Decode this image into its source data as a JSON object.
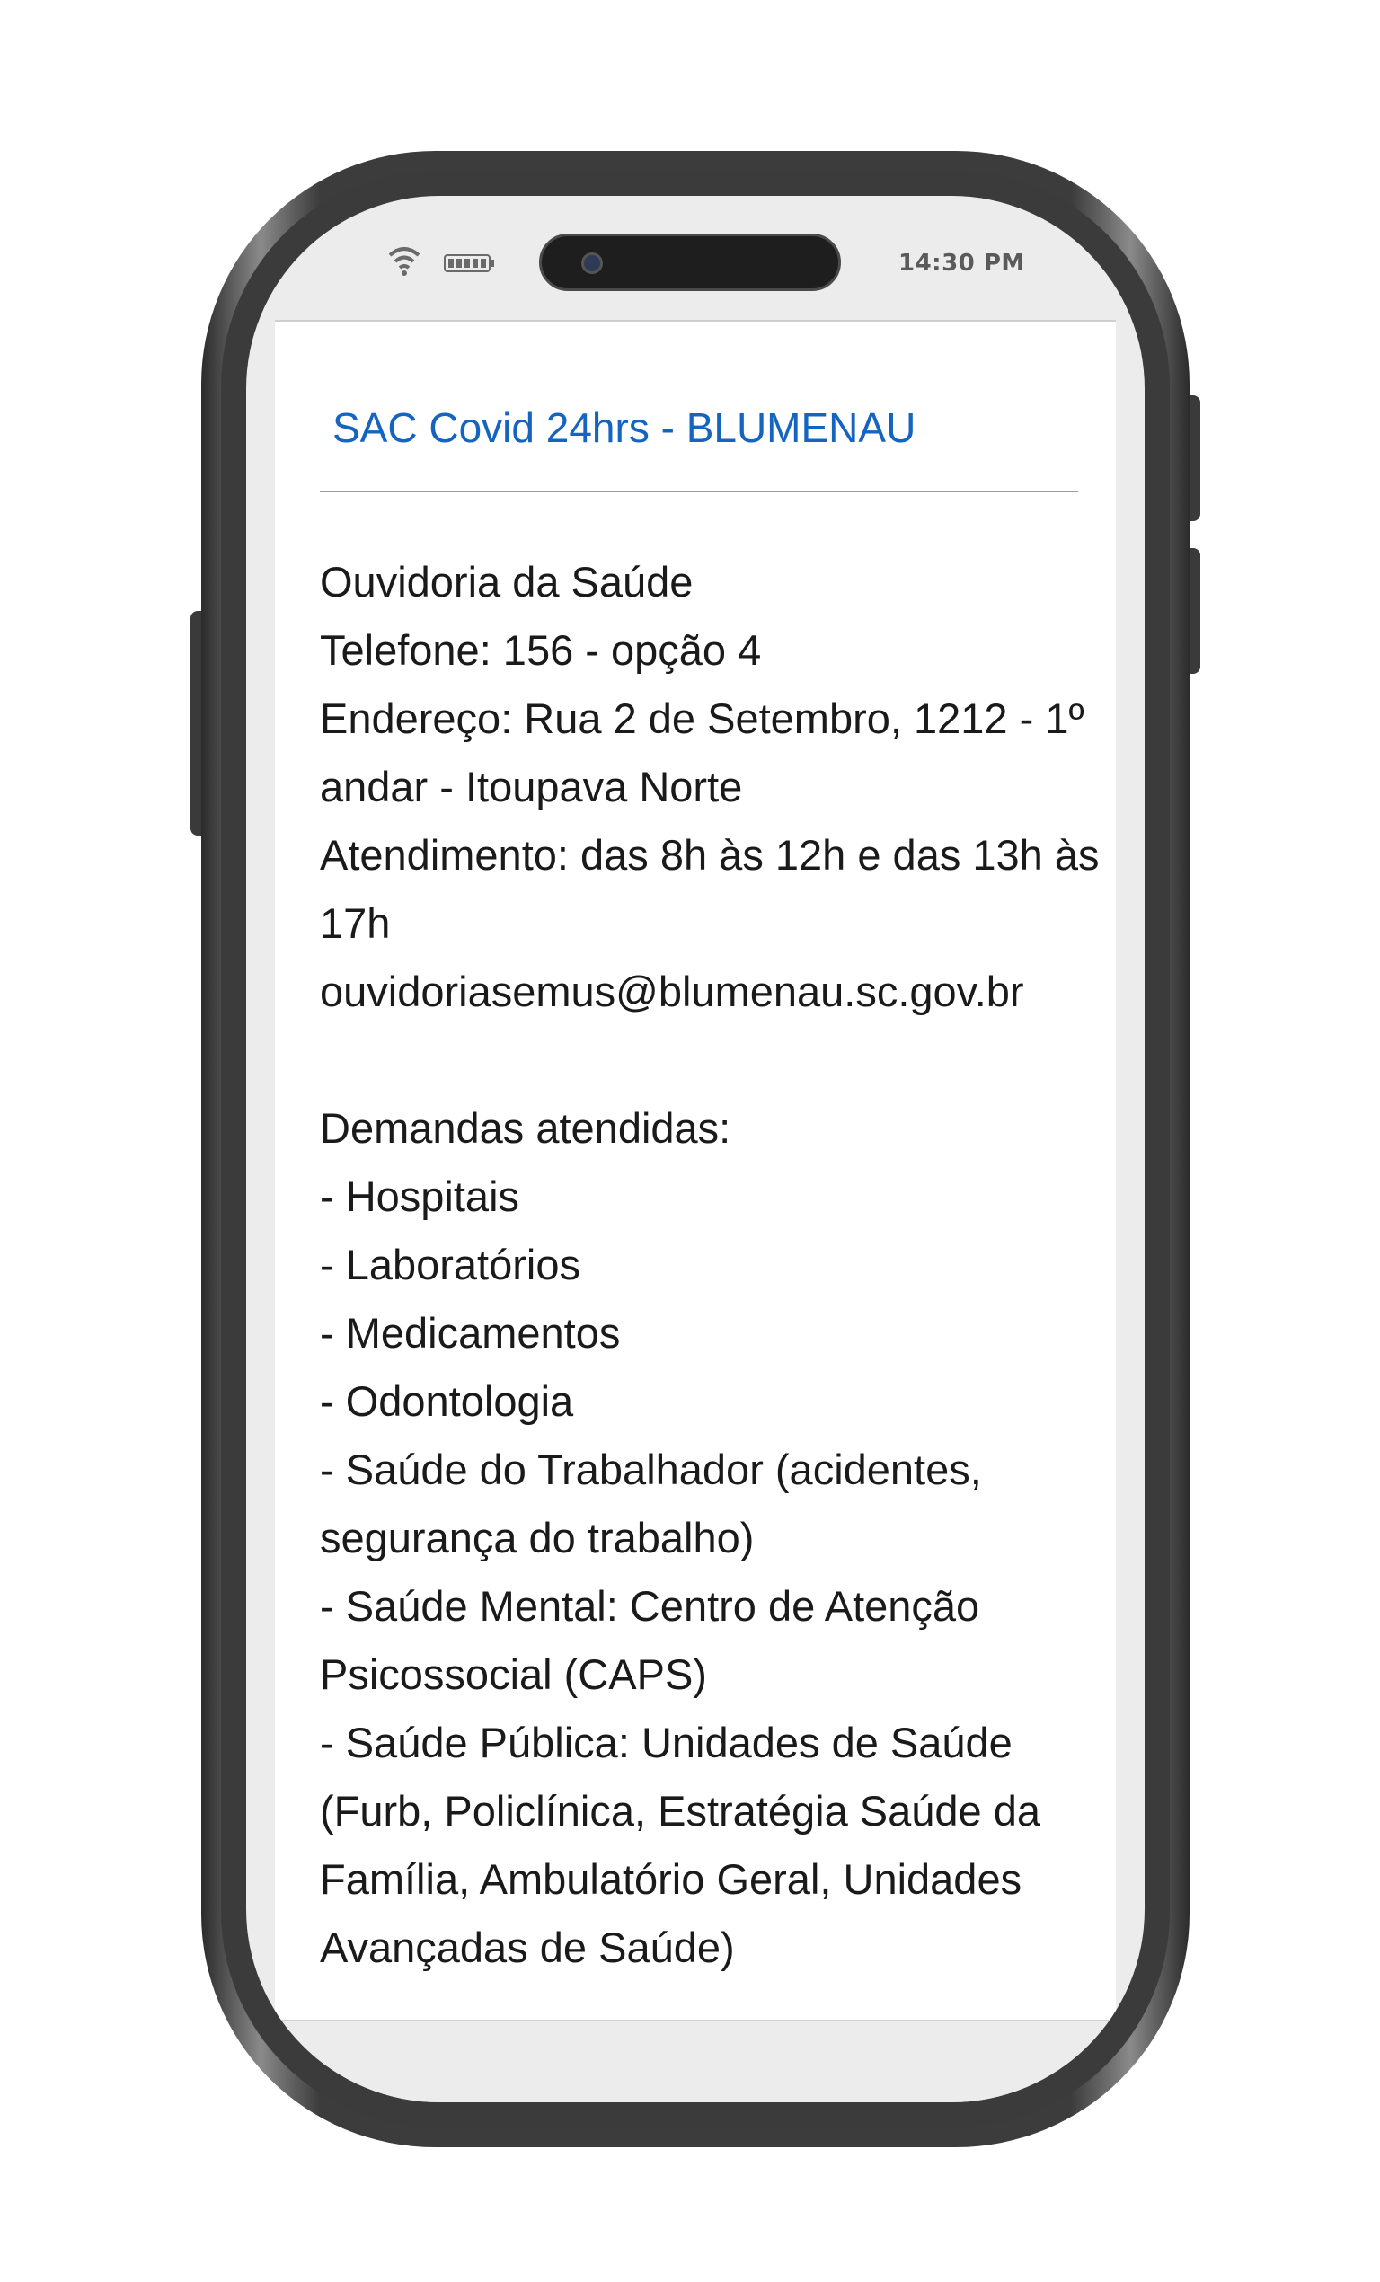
{
  "status_bar": {
    "time": "14:30 PM",
    "icons": [
      "wifi-icon",
      "battery-icon",
      "front-camera-icon"
    ]
  },
  "page": {
    "title": "SAC Covid 24hrs - BLUMENAU",
    "contact": [
      "Ouvidoria da Saúde",
      "Telefone: 156 - opção 4",
      "Endereço: Rua 2 de Setembro, 1212 - 1º",
      "andar - Itoupava Norte",
      "Atendimento: das 8h às 12h e das 13h às",
      "17h",
      "ouvidoriasemus@blumenau.sc.gov.br"
    ],
    "demandas": [
      "Demandas atendidas:",
      "- Hospitais",
      "- Laboratórios",
      "- Medicamentos",
      "- Odontologia",
      "- Saúde do Trabalhador (acidentes,",
      "segurança do trabalho)",
      "- Saúde Mental: Centro de Atenção",
      "Psicossocial (CAPS)",
      "- Saúde Pública: Unidades de Saúde",
      "(Furb, Policlínica, Estratégia Saúde da",
      "Família, Ambulatório Geral, Unidades",
      "Avançadas de Saúde)"
    ]
  },
  "colors": {
    "title": "#1565c0",
    "text": "#1a1a1a",
    "frame": "#3b3b3b",
    "bezel": "#ececec"
  }
}
